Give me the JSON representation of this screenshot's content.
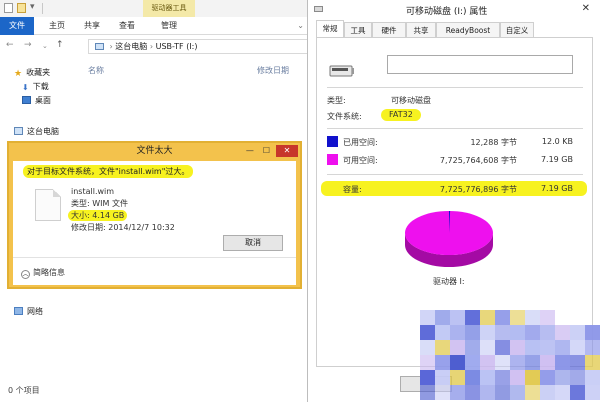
{
  "explorer": {
    "context_tab": "驱动器工具",
    "ribbon_tabs": [
      "文件",
      "主页",
      "共享",
      "查看",
      "管理"
    ],
    "address_parts": [
      "这台电脑",
      "USB-TF (I:)"
    ],
    "sidebar": {
      "favorites": "收藏夹",
      "downloads": "下载",
      "desktop": "桌面",
      "this_pc": "这台电脑",
      "network": "网络"
    },
    "columns": {
      "name": "名称",
      "modified": "修改日期"
    },
    "status": "0 个项目"
  },
  "dialog": {
    "title": "文件太大",
    "message": "对于目标文件系统，文件\"install.wim\"过大。",
    "file_name": "install.wim",
    "file_type": "类型: WIM 文件",
    "file_size": "大小: 4.14 GB",
    "file_modified": "修改日期: 2014/12/7 10:32",
    "cancel_label": "取消",
    "details_label": "简略信息",
    "controls": {
      "minimize": "—",
      "maximize": "☐",
      "close": "✕"
    }
  },
  "properties": {
    "title": "可移动磁盘 (I:) 属性",
    "tabs": [
      "常规",
      "工具",
      "硬件",
      "共享",
      "ReadyBoost",
      "自定义"
    ],
    "active_tab": "常规",
    "type_label": "类型:",
    "type_value": "可移动磁盘",
    "fs_label": "文件系统:",
    "fs_value": "FAT32",
    "used_label": "已用空间:",
    "used_bytes": "12,288 字节",
    "used_size": "12.0 KB",
    "free_label": "可用空间:",
    "free_bytes": "7,725,764,608 字节",
    "free_size": "7.19 GB",
    "capacity_label": "容量:",
    "capacity_bytes": "7,725,776,896 字节",
    "capacity_size": "7.19 GB",
    "drive_label": "驱动器 I:",
    "used_color": "#1111cc",
    "free_color": "#ee10ee"
  },
  "colors": {
    "ribbon_file": "#1c66c8",
    "dialog_frame": "#f3c24c",
    "highlight": "#f7f220",
    "close_button": "#c7362b"
  }
}
